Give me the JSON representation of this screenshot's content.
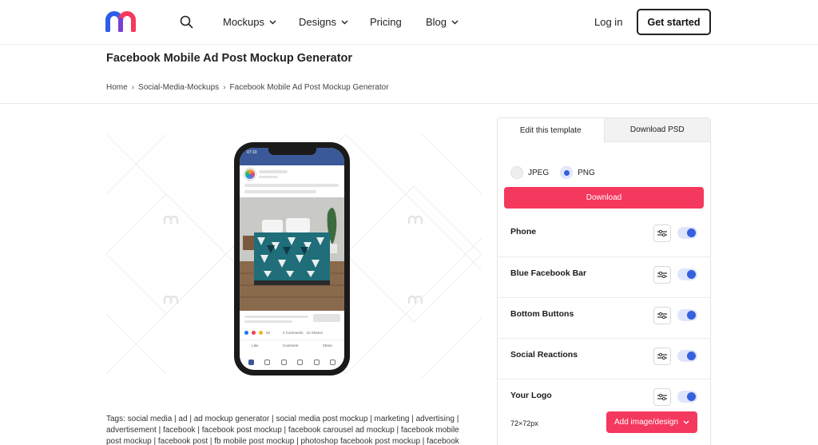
{
  "header": {
    "nav": [
      {
        "label": "Mockups",
        "has_dropdown": true
      },
      {
        "label": "Designs",
        "has_dropdown": true
      },
      {
        "label": "Pricing",
        "has_dropdown": false
      },
      {
        "label": "Blog",
        "has_dropdown": true
      }
    ],
    "login_label": "Log in",
    "cta_label": "Get started",
    "logo_colors": {
      "left": "#2f5bea",
      "right": "#f5385e"
    }
  },
  "page": {
    "title": "Facebook Mobile Ad Post Mockup Generator",
    "breadcrumb": [
      "Home",
      "Social-Media-Mockups",
      "Facebook Mobile Ad Post Mockup Generator"
    ]
  },
  "preview": {
    "status_time": "07:10",
    "reaction_count": "62",
    "comments": "2 Comments",
    "shares": "10 Shares",
    "actions": [
      "Like",
      "Comment",
      "Share"
    ]
  },
  "tags_text": "Tags: social media | ad | ad mockup generator | social media post mockup | marketing | advertising | advertisement | facebook | facebook post mockup | facebook carousel ad mockup | facebook mobile post mockup | facebook post | fb mobile post mockup | photoshop facebook post mockup | facebook",
  "panel": {
    "tabs": [
      {
        "label": "Edit this template",
        "active": true
      },
      {
        "label": "Download PSD",
        "active": false
      }
    ],
    "formats": [
      {
        "label": "JPEG",
        "selected": false
      },
      {
        "label": "PNG",
        "selected": true
      }
    ],
    "download_label": "Download",
    "options": [
      {
        "label": "Phone",
        "enabled": true
      },
      {
        "label": "Blue Facebook Bar",
        "enabled": true
      },
      {
        "label": "Bottom Buttons",
        "enabled": true
      },
      {
        "label": "Social Reactions",
        "enabled": true
      },
      {
        "label": "Your Logo",
        "enabled": true
      }
    ],
    "logo_size": "72×72px",
    "add_image_label": "Add image/design",
    "accent_color": "#f5385e",
    "toggle_color": "#3560e0"
  }
}
